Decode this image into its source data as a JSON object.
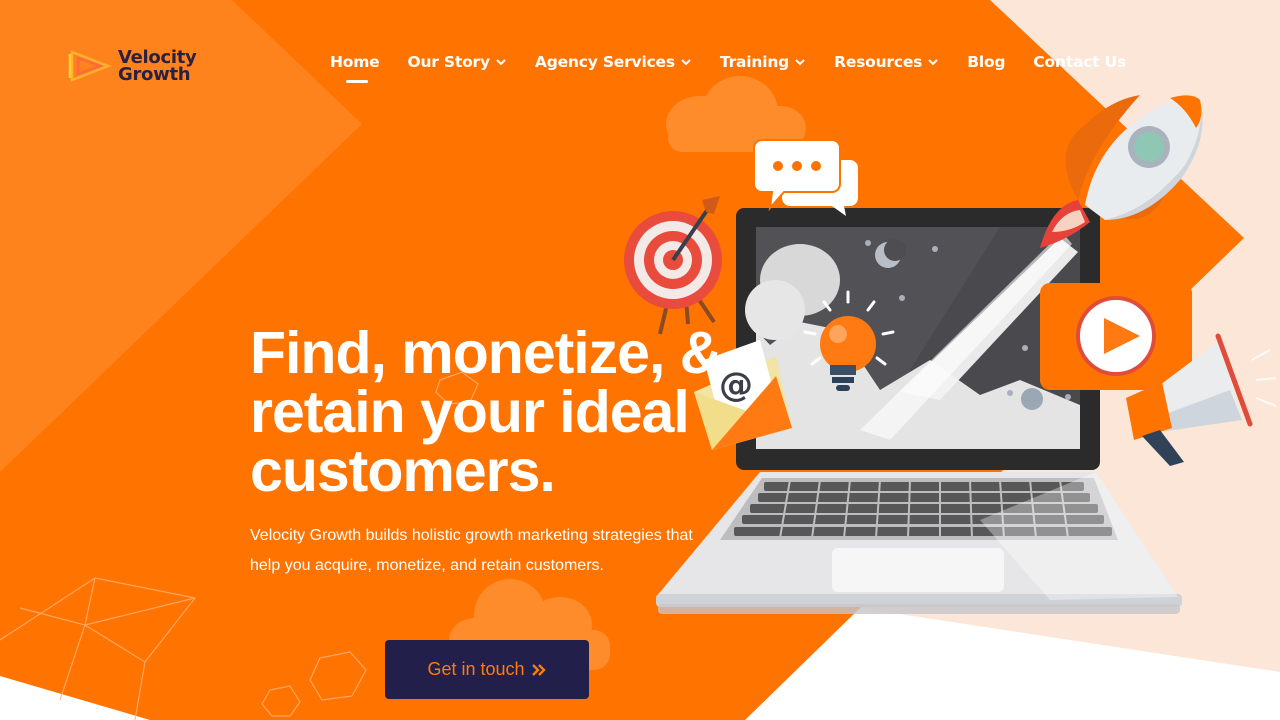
{
  "colors": {
    "brand_orange": "#ff7300",
    "peach": "#fce6d7",
    "navy": "#221f4a",
    "white": "#ffffff"
  },
  "brand": {
    "line1": "Velocity",
    "line2": "Growth"
  },
  "nav": {
    "items": [
      {
        "label": "Home",
        "active": true,
        "dropdown": false
      },
      {
        "label": "Our Story",
        "dropdown": true
      },
      {
        "label": "Agency Services",
        "dropdown": true
      },
      {
        "label": "Training",
        "dropdown": true
      },
      {
        "label": "Resources",
        "dropdown": true
      },
      {
        "label": "Blog",
        "dropdown": false
      },
      {
        "label": "Contact Us",
        "dropdown": false
      }
    ]
  },
  "hero": {
    "title_lines": [
      "Find, monetize, &",
      "retain your ideal",
      "customers."
    ],
    "subtitle": "Velocity Growth builds holistic growth marketing strategies that help you acquire, monetize, and retain customers.",
    "cta_label": "Get in touch"
  },
  "illustration": {
    "icons": [
      "chat-bubble-icon",
      "target-icon",
      "arrow-icon",
      "rocket-icon",
      "lightbulb-icon",
      "email-icon",
      "video-play-icon",
      "megaphone-icon",
      "laptop-icon",
      "cloud-icon",
      "moon-icon",
      "star-icon"
    ],
    "email_symbol": "@"
  }
}
